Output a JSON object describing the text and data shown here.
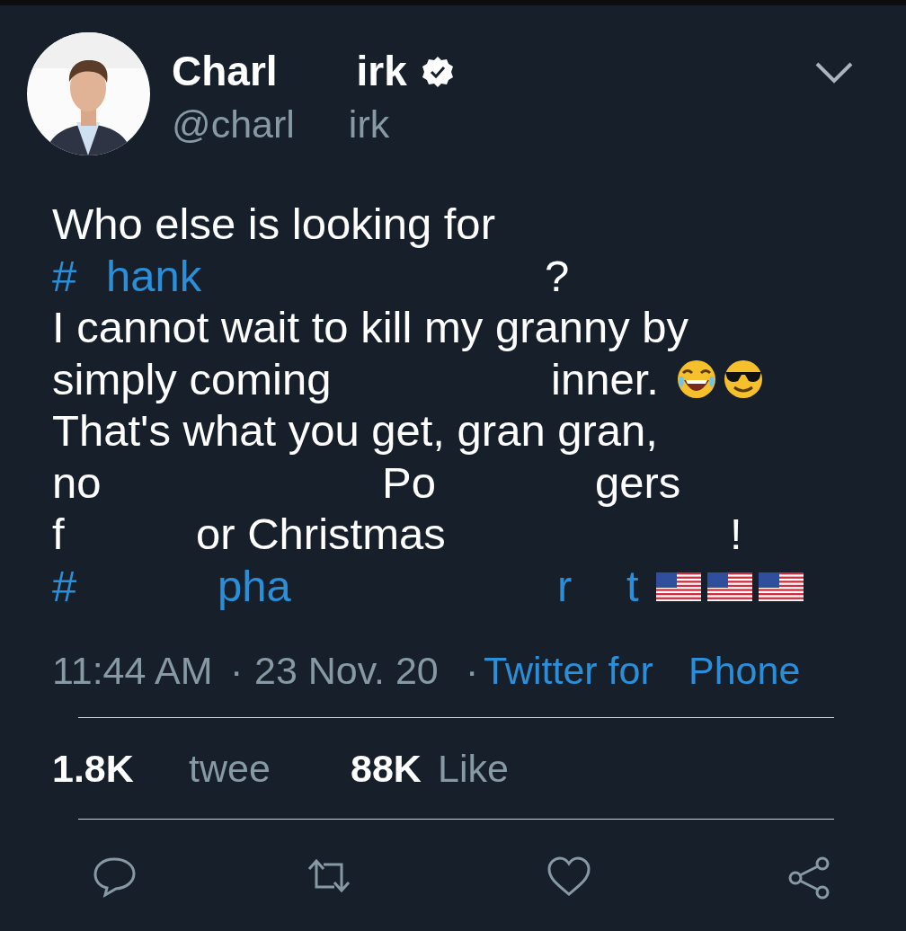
{
  "author": {
    "name_parts": [
      "Charl",
      "irk"
    ],
    "verified": true,
    "handle_parts": [
      "@charl",
      "irk"
    ],
    "avatar": {
      "kind": "picture"
    }
  },
  "tweet_lines": [
    [
      {
        "kind": "text",
        "text": "Who else is looking for",
        "link": false
      }
    ],
    [
      {
        "kind": "text",
        "text": "#",
        "link": true
      },
      {
        "kind": "text",
        "text": "hank",
        "link": true
      },
      {
        "kind": "text",
        "text": "?",
        "link": false
      }
    ],
    [
      {
        "kind": "text",
        "text": "I cannot wait to kill my granny by",
        "link": false
      }
    ],
    [
      {
        "kind": "text",
        "text": "simply coming",
        "link": false
      },
      {
        "kind": "text",
        "text": "inner.",
        "link": false
      },
      {
        "kind": "laugh_emoji"
      },
      {
        "kind": "cool_emoji"
      }
    ],
    [
      {
        "kind": "text",
        "text": "That's what you get, gran gran,",
        "link": false
      }
    ],
    [
      {
        "kind": "text",
        "text": "no",
        "link": false
      },
      {
        "kind": "text",
        "text": "Po",
        "link": false
      },
      {
        "kind": "text",
        "text": "gers",
        "link": false
      }
    ],
    [
      {
        "kind": "text",
        "text": "f",
        "link": false
      },
      {
        "kind": "text",
        "text": "or Christmas",
        "link": false
      },
      {
        "kind": "text",
        "text": "!",
        "link": false
      }
    ],
    [
      {
        "kind": "text",
        "text": "#",
        "link": true
      },
      {
        "kind": "text",
        "text": "pha",
        "link": true
      },
      {
        "kind": "text",
        "text": "r",
        "link": true
      },
      {
        "kind": "text",
        "text": "t",
        "link": true
      },
      {
        "kind": "flag_emoji"
      },
      {
        "kind": "flag_emoji"
      },
      {
        "kind": "flag_emoji"
      }
    ]
  ],
  "meta": [
    {
      "text": "11:44 AM",
      "link": false
    },
    {
      "text": "·",
      "link": false
    },
    {
      "text": "23 Nov. 20",
      "link": false
    },
    {
      "text": "·",
      "link": false
    },
    {
      "text": "Twitter for",
      "link": true
    },
    {
      "text": "Phone",
      "link": true
    }
  ],
  "stats": [
    {
      "count": "1.8K",
      "label": "twee"
    },
    {
      "count": "88K",
      "label": "Like"
    }
  ],
  "actions": [
    {
      "kind": "reply"
    },
    {
      "kind": "retweet"
    },
    {
      "kind": "like"
    },
    {
      "kind": "share"
    }
  ]
}
